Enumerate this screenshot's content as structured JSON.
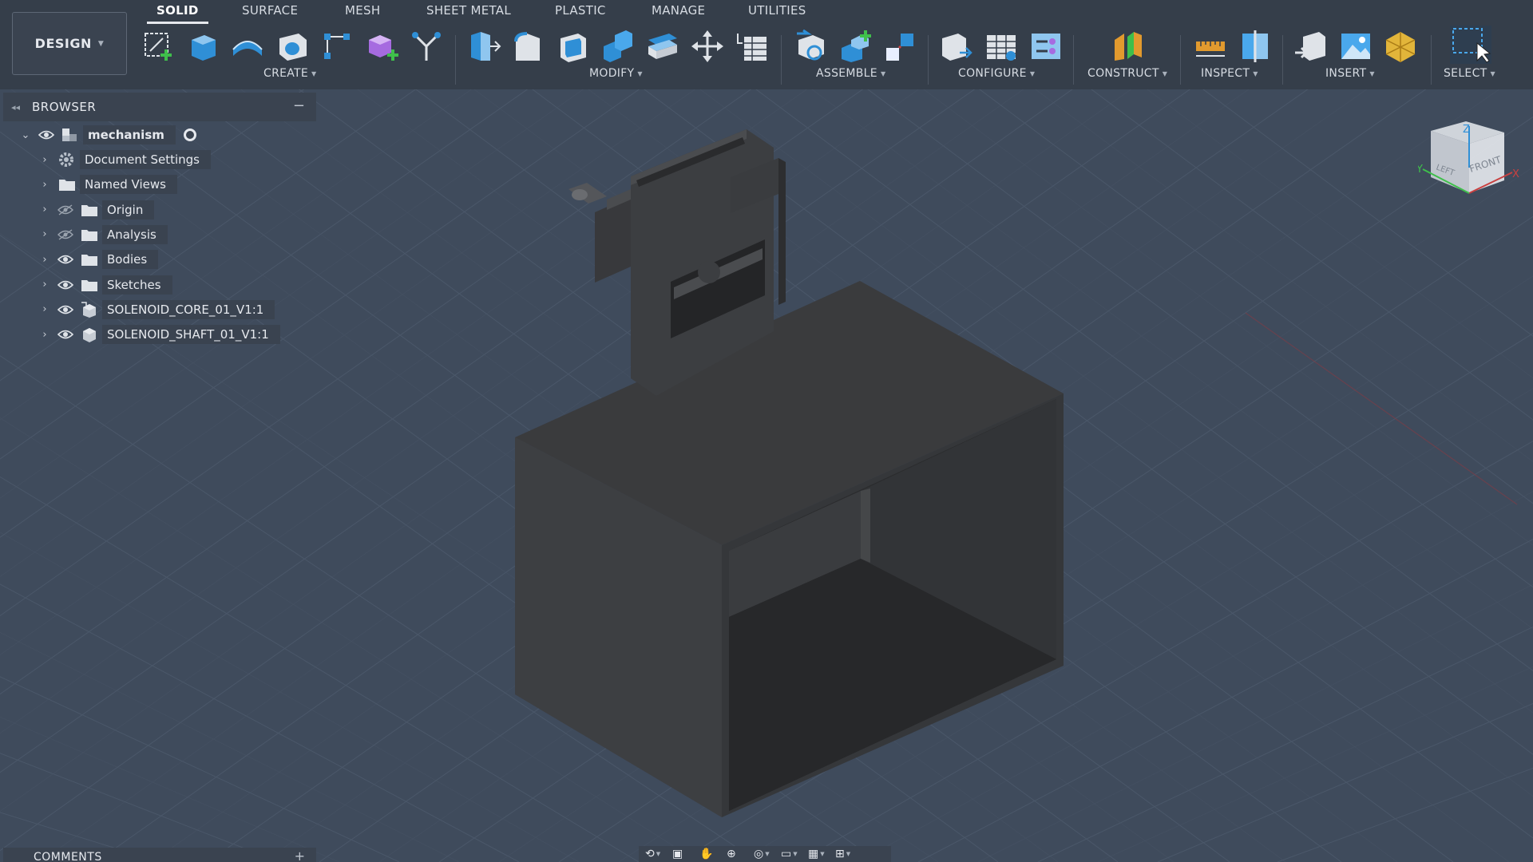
{
  "toolbar": {
    "workspace": "DESIGN",
    "tabs": [
      "SOLID",
      "SURFACE",
      "MESH",
      "SHEET METAL",
      "PLASTIC",
      "MANAGE",
      "UTILITIES"
    ],
    "active_tab": "SOLID",
    "groups": {
      "create": "CREATE",
      "modify": "MODIFY",
      "assemble": "ASSEMBLE",
      "configure": "CONFIGURE",
      "construct": "CONSTRUCT",
      "inspect": "INSPECT",
      "insert": "INSERT",
      "select": "SELECT"
    },
    "icons": {
      "create": [
        "create-sketch-icon",
        "extrude-icon",
        "revolve-icon",
        "hole-icon",
        "pattern-icon",
        "new-component-icon",
        "derive-icon"
      ],
      "modify": [
        "press-pull-icon",
        "fillet-icon",
        "shell-icon",
        "combine-icon",
        "offset-face-icon",
        "move-icon",
        "change-parameters-icon"
      ],
      "assemble": [
        "joint-icon",
        "new-component-assemble-icon",
        "rigid-group-icon"
      ],
      "configure": [
        "configure-icon",
        "table-icon",
        "configure-rules-icon"
      ],
      "construct": [
        "construct-plane-icon"
      ],
      "inspect": [
        "measure-icon",
        "section-analysis-icon"
      ],
      "insert": [
        "insert-derive-icon",
        "insert-image-icon",
        "insert-mesh-icon"
      ],
      "select": [
        "select-window-icon"
      ]
    }
  },
  "browser": {
    "title": "BROWSER",
    "root": "mechanism",
    "items": [
      {
        "label": "Document Settings",
        "icon": "gear-icon",
        "visible": null
      },
      {
        "label": "Named Views",
        "icon": "folder-icon",
        "visible": null
      },
      {
        "label": "Origin",
        "icon": "folder-icon",
        "visible": false
      },
      {
        "label": "Analysis",
        "icon": "folder-icon",
        "visible": false
      },
      {
        "label": "Bodies",
        "icon": "folder-icon",
        "visible": true
      },
      {
        "label": "Sketches",
        "icon": "folder-icon",
        "visible": true
      },
      {
        "label": "SOLENOID_CORE_01_V1:1",
        "icon": "linked-component-icon",
        "visible": true
      },
      {
        "label": "SOLENOID_SHAFT_01_V1:1",
        "icon": "component-icon",
        "visible": true
      }
    ]
  },
  "comments": {
    "title": "COMMENTS"
  },
  "viewcube": {
    "top": "Z",
    "left": "LEFT",
    "front": "FRONT",
    "y_axis": "Y",
    "x_axis": "X"
  },
  "colors": {
    "toolbar": "#353e4a",
    "panel": "#3a4350",
    "viewport": "#3f4b5c",
    "model": "#3b3d40",
    "accent_blue": "#2f8fd6"
  }
}
